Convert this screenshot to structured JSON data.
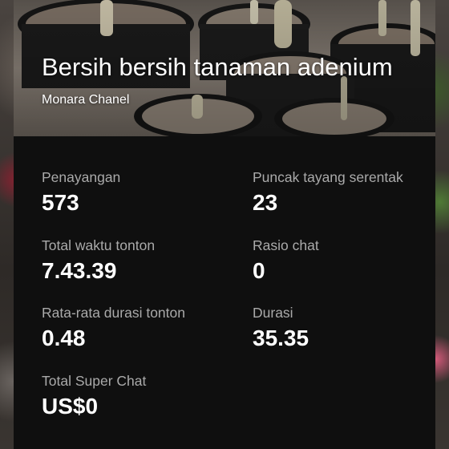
{
  "video": {
    "title": "Bersih bersih tanaman adenium",
    "channel": "Monara Chanel"
  },
  "stats": [
    {
      "label": "Penayangan",
      "value": "573"
    },
    {
      "label": "Puncak tayang serentak",
      "value": "23"
    },
    {
      "label": "Total waktu tonton",
      "value": "7.43.39"
    },
    {
      "label": "Rasio chat",
      "value": "0"
    },
    {
      "label": "Rata-rata durasi tonton",
      "value": "0.48"
    },
    {
      "label": "Durasi",
      "value": "35.35"
    },
    {
      "label": "Total Super Chat",
      "value": "US$0"
    }
  ]
}
